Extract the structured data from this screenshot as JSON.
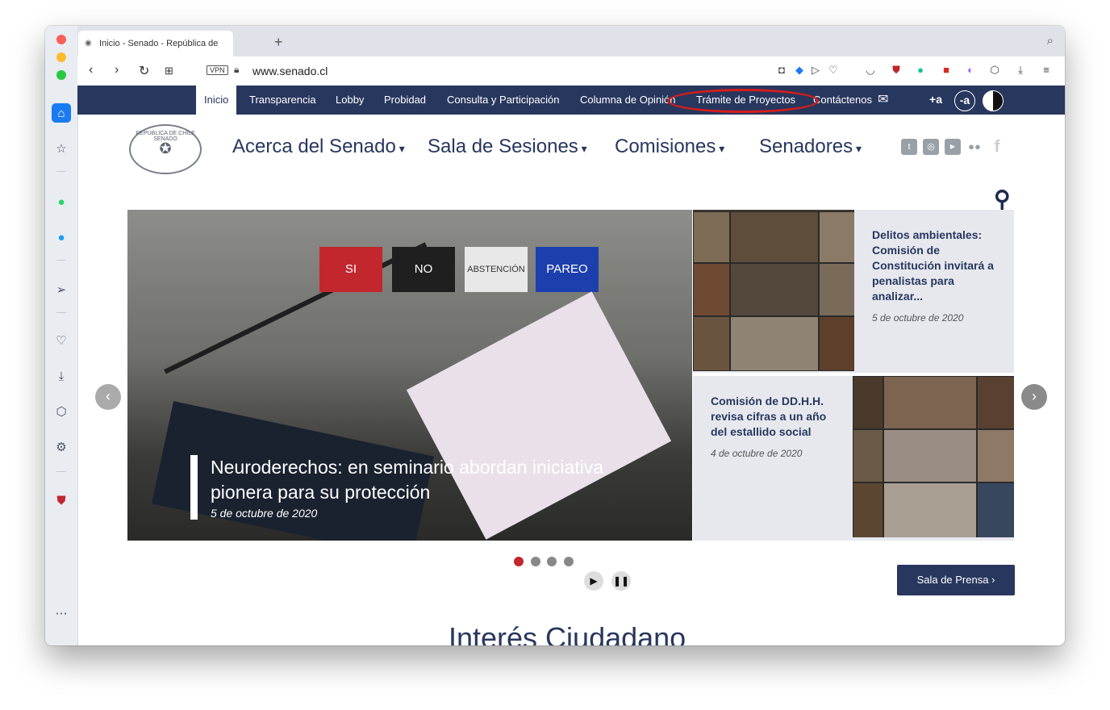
{
  "browser": {
    "tab_title": "Inicio - Senado - República de",
    "new_tab": "+",
    "url": "www.senado.cl",
    "vpn": "VPN"
  },
  "topnav": {
    "items": [
      "Inicio",
      "Transparencia",
      "Lobby",
      "Probidad",
      "Consulta y Participación",
      "Columna de Opinión",
      "Trámite de Proyectos",
      "Contáctenos"
    ],
    "font_larger": "+a",
    "font_smaller": "-a"
  },
  "logo": {
    "text": "REPUBLICA DE CHILE SENADO"
  },
  "mainnav": {
    "items": [
      "Acerca del Senado",
      "Sala de Sesiones",
      "Comisiones",
      "Senadores"
    ]
  },
  "social": [
    "twitter",
    "instagram",
    "youtube",
    "flickr",
    "facebook"
  ],
  "hero": {
    "votes": [
      "SI",
      "NO",
      "ABSTENCIÓN",
      "PAREO"
    ],
    "title": "Neuroderechos: en seminario abordan iniciativa pionera para su protección",
    "date": "5 de octubre de 2020"
  },
  "side_news": [
    {
      "title": "Delitos ambientales: Comisión de Constitución invitará a penalistas para analizar...",
      "date": "5 de octubre de 2020"
    },
    {
      "title": "Comisión de DD.H.H. revisa cifras a un año del estallido social",
      "date": "4 de octubre de 2020"
    }
  ],
  "press_button": "Sala de Prensa",
  "section_title": "Interés Ciudadano",
  "colors": {
    "navy": "#28375e",
    "highlight": "#d41d1d"
  }
}
